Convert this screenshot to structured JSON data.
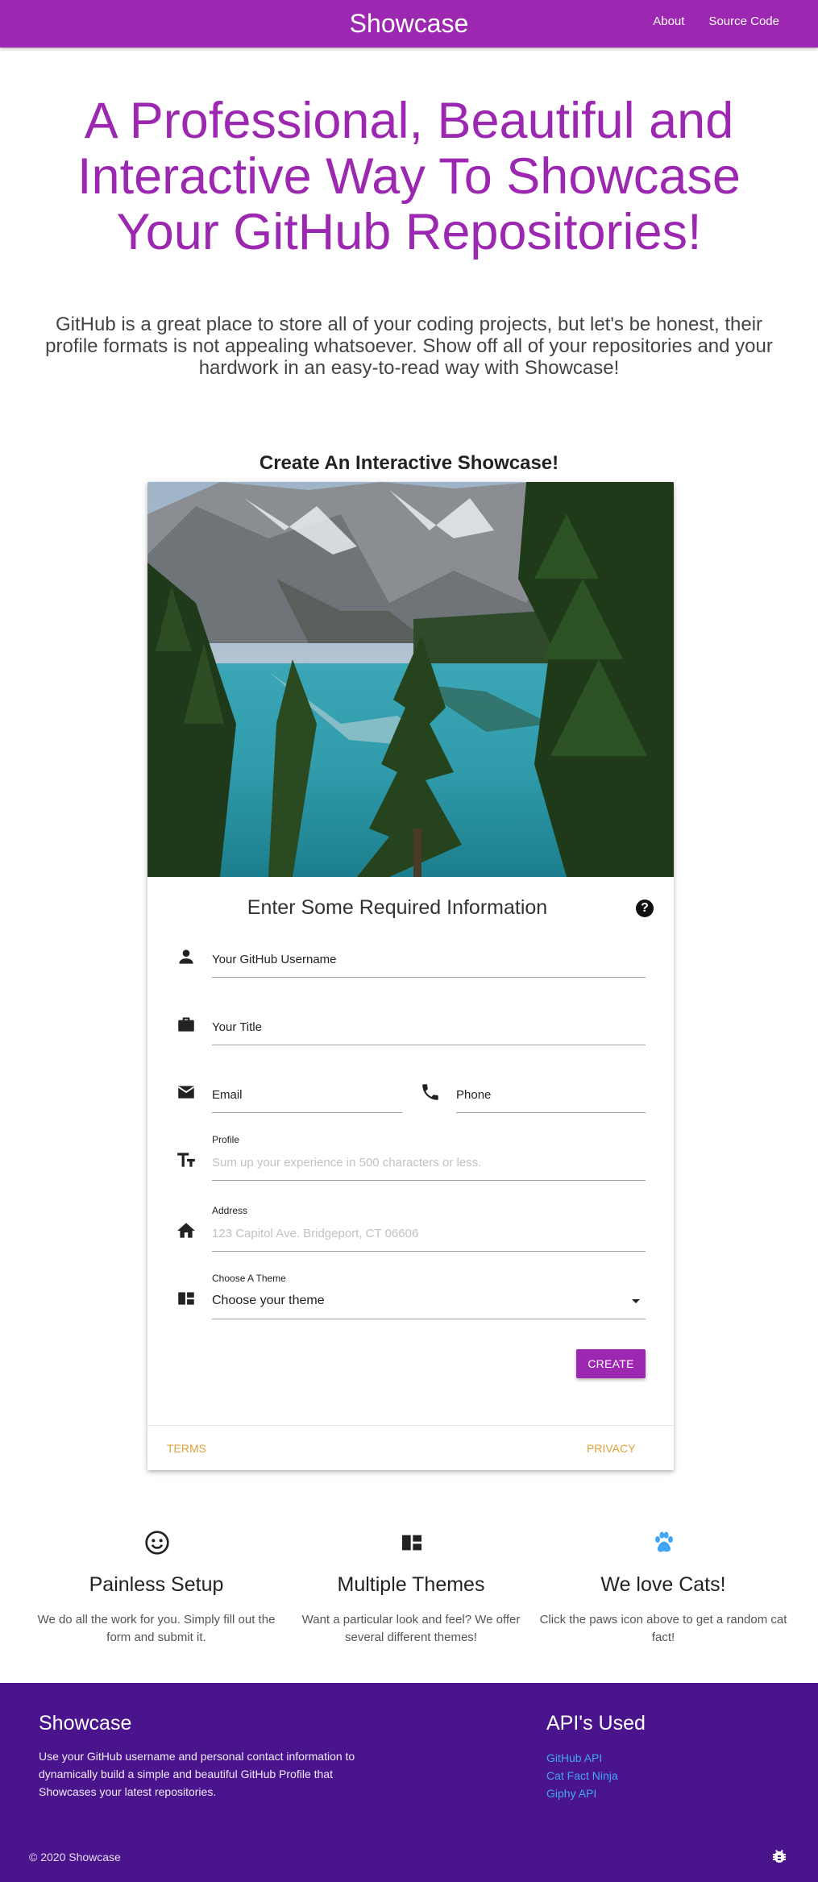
{
  "nav": {
    "brand": "Showcase",
    "links": [
      "About",
      "Source Code"
    ]
  },
  "hero": {
    "title": "A Professional, Beautiful and Interactive Way To Showcase Your GitHub Repositories!",
    "subtitle": "GitHub is a great place to store all of your coding projects, but let's be honest, their profile formats is not appealing whatsoever. Show off all of your repositories and your hardwork in an easy-to-read way with Showcase!"
  },
  "section_title": "Create An Interactive Showcase!",
  "form": {
    "title": "Enter Some Required Information",
    "username_label": "Your GitHub Username",
    "title_label": "Your Title",
    "email_label": "Email",
    "phone_label": "Phone",
    "profile_label": "Profile",
    "profile_placeholder": "Sum up your experience in 500 characters or less.",
    "address_label": "Address",
    "address_placeholder": "123 Capitol Ave. Bridgeport, CT 06606",
    "theme_label": "Choose A Theme",
    "theme_value": "Choose your theme",
    "create_label": "Create",
    "terms_label": "Terms",
    "privacy_label": "Privacy"
  },
  "features": [
    {
      "icon": "smiley-icon",
      "title": "Painless Setup",
      "text": "We do all the work for you. Simply fill out the form and submit it."
    },
    {
      "icon": "dashboard-icon",
      "title": "Multiple Themes",
      "text": "Want a particular look and feel? We offer several different themes!"
    },
    {
      "icon": "paw-icon",
      "title": "We love Cats!",
      "text": "Click the paws icon above to get a random cat fact!"
    }
  ],
  "footer": {
    "brand": "Showcase",
    "description": "Use your GitHub username and personal contact information to dynamically build a simple and beautiful GitHub Profile that Showcases your latest repositories.",
    "apis_title": "API's Used",
    "apis": [
      "GitHub API",
      "Cat Fact Ninja",
      "Giphy API"
    ],
    "copyright": "© 2020 Showcase"
  },
  "colors": {
    "primary": "#9c27b0",
    "footer": "#4a148c",
    "link": "#42a5f5",
    "action": "#e0a03a"
  }
}
